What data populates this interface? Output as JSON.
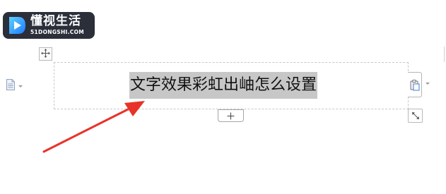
{
  "logo": {
    "text_cn": "懂视生活",
    "text_en": "51DONGSHI.COM",
    "bg_color": "#2a2f3a"
  },
  "toolbar": {
    "move_handle_icon": "move-arrows-icon",
    "doc_icon": "document-icon",
    "paste_icon": "paste-options-icon",
    "add_row_icon": "plus-icon",
    "resize_icon": "resize-arrows-icon"
  },
  "document": {
    "selected_text": "文字效果彩虹出岫怎么设置",
    "selection_color": "#c7c7c7"
  },
  "annotation": {
    "arrow_color": "#e8332a",
    "arrow_icon": "red-arrow-annotation"
  }
}
